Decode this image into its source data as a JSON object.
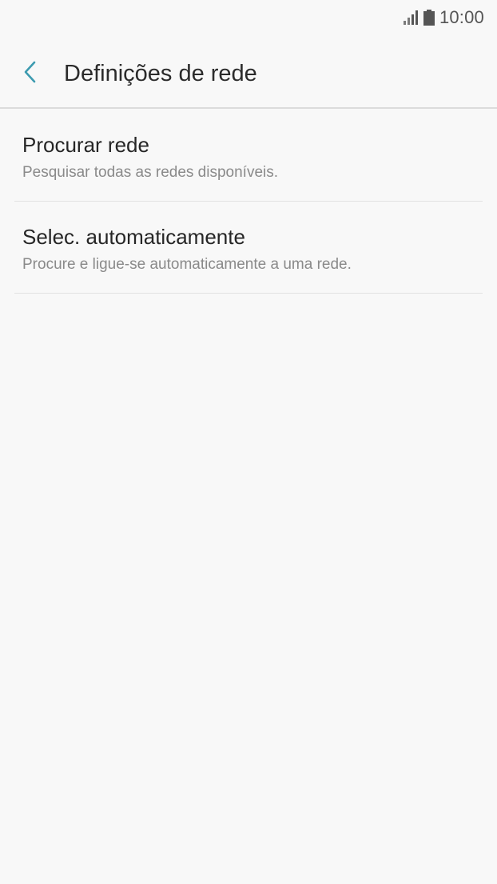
{
  "status_bar": {
    "time": "10:00",
    "signal_icon": "signal-icon",
    "battery_icon": "battery-icon"
  },
  "header": {
    "title": "Definições de rede",
    "back_icon": "chevron-left-icon",
    "accent_color": "#3d9bb0"
  },
  "items": [
    {
      "title": "Procurar rede",
      "subtitle": "Pesquisar todas as redes disponíveis."
    },
    {
      "title": "Selec. automaticamente",
      "subtitle": "Procure e ligue-se automaticamente a uma rede."
    }
  ]
}
